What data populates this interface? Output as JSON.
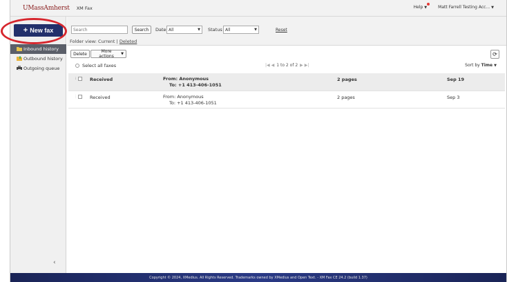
{
  "header": {
    "brand": "UMassAmherst",
    "app_name": "XM Fax",
    "help_label": "Help",
    "user_label": "Matt Farrell Testing Acc..."
  },
  "sidebar": {
    "new_fax_label": "New fax",
    "items": [
      {
        "label": "Inbound history",
        "icon": "folder-icon",
        "active": true
      },
      {
        "label": "Outbound history",
        "icon": "outbox-folder-icon",
        "active": false
      },
      {
        "label": "Outgoing queue",
        "icon": "printer-queue-icon",
        "active": false
      }
    ],
    "collapse_glyph": "‹"
  },
  "filters": {
    "search_placeholder": "Search",
    "search_button": "Search",
    "date_label": "Date",
    "date_value": "All",
    "status_label": "Status",
    "status_value": "All",
    "reset_label": "Reset",
    "folder_view_prefix": "Folder view:",
    "folder_view_current": "Current",
    "folder_view_sep": "|",
    "folder_view_deleted": "Deleted"
  },
  "toolbar": {
    "delete_label": "Delete",
    "more_actions_label": "More actions",
    "select_all_label": "Select all faxes",
    "pager_text": "1 to 2 of 2",
    "sort_prefix": "Sort by",
    "sort_field": "Time"
  },
  "table": {
    "header": {
      "received": "Received",
      "from": "From: Anonymous",
      "to": "To: +1 413-406-1051",
      "pages": "2 pages",
      "date": "Sep 19"
    },
    "rows": [
      {
        "received": "Received",
        "from": "From: Anonymous",
        "to": "To: +1 413-406-1051",
        "pages": "2 pages",
        "date": "Sep 3"
      }
    ]
  },
  "footer": {
    "text": "Copyright © 2024, XMedius. All Rights Reserved. Trademarks owned by XMedius and Open Text. - XM Fax CE 24.2 (build 1.37)"
  },
  "colors": {
    "brand_maroon": "#881c1c",
    "primary_navy": "#22306b",
    "highlight_red": "#d6262d",
    "active_nav": "#5b5f69"
  }
}
